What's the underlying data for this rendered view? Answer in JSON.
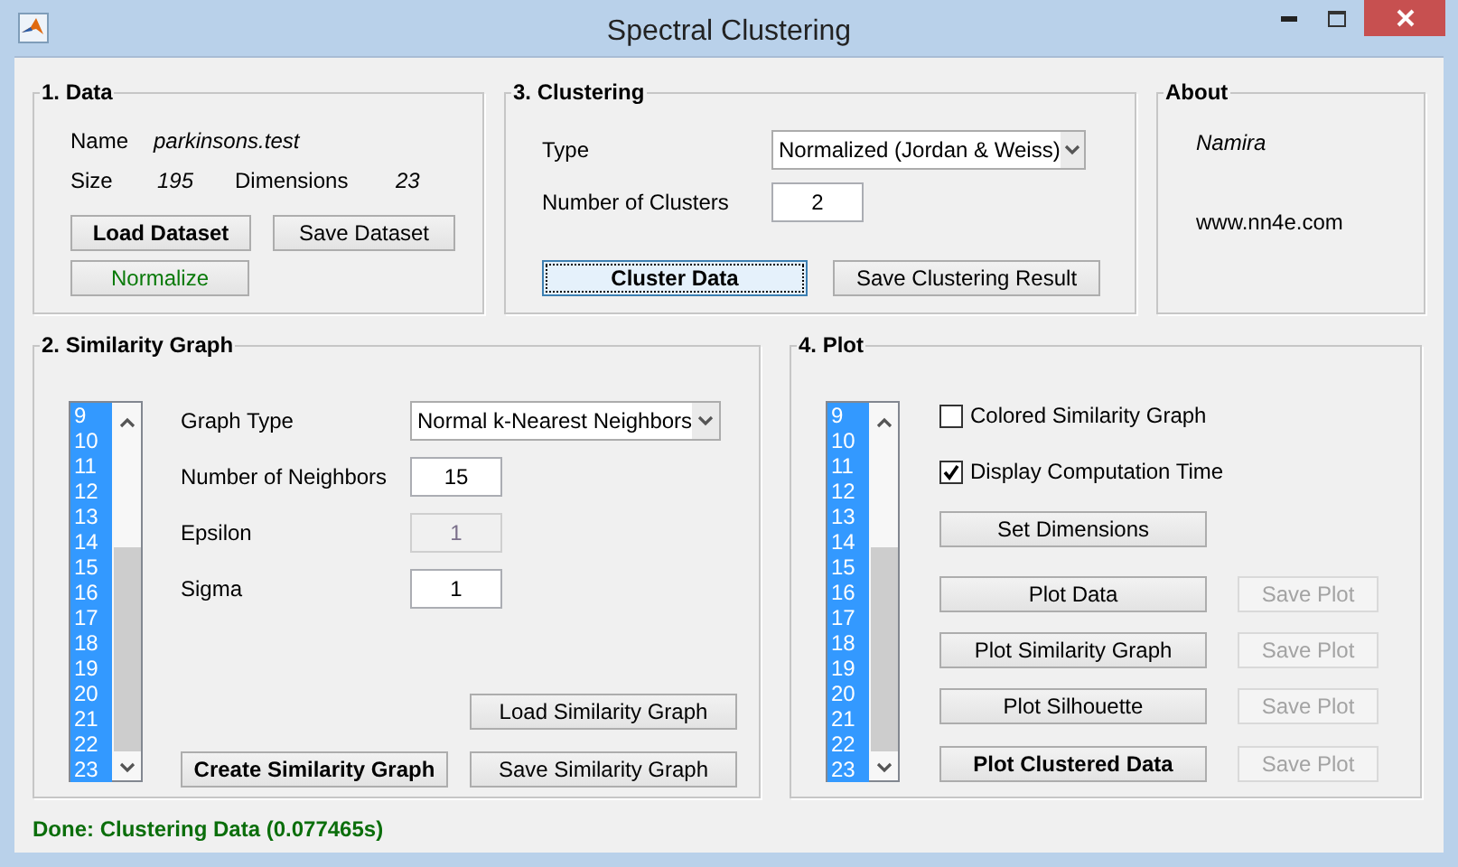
{
  "window": {
    "title": "Spectral Clustering"
  },
  "data_panel": {
    "title": "1. Data",
    "name_label": "Name",
    "name_value": "parkinsons.test",
    "size_label": "Size",
    "size_value": "195",
    "dimensions_label": "Dimensions",
    "dimensions_value": "23",
    "buttons": [
      {
        "label": "Load Dataset",
        "kind": "bold"
      },
      {
        "label": "Save Dataset",
        "kind": "plain"
      },
      {
        "label": "Normalize",
        "kind": "green"
      }
    ]
  },
  "clustering_panel": {
    "title": "3. Clustering",
    "type_label": "Type",
    "type_value": "Normalized (Jordan & Weiss)",
    "clusters_label": "Number of Clusters",
    "clusters_value": "2",
    "buttons": [
      {
        "label": "Cluster Data",
        "kind": "bold",
        "focused": true
      },
      {
        "label": "Save Clustering Result",
        "kind": "plain",
        "focused": false
      }
    ]
  },
  "about_panel": {
    "title": "About",
    "author": "Namira",
    "website": "www.nn4e.com"
  },
  "similarity_panel": {
    "title": "2. Similarity Graph",
    "list": [
      {
        "label": "9",
        "selected": true
      },
      {
        "label": "10",
        "selected": true
      },
      {
        "label": "11",
        "selected": true
      },
      {
        "label": "12",
        "selected": true
      },
      {
        "label": "13",
        "selected": true
      },
      {
        "label": "14",
        "selected": true
      },
      {
        "label": "15",
        "selected": true
      },
      {
        "label": "16",
        "selected": true
      },
      {
        "label": "17",
        "selected": true
      },
      {
        "label": "18",
        "selected": true
      },
      {
        "label": "19",
        "selected": true
      },
      {
        "label": "20",
        "selected": true
      },
      {
        "label": "21",
        "selected": true
      },
      {
        "label": "22",
        "selected": true
      },
      {
        "label": "23",
        "selected": true
      }
    ],
    "graph_type_label": "Graph Type",
    "graph_type_value": "Normal k-Nearest Neighbors",
    "fields": [
      {
        "label": "Number of Neighbors",
        "value": "15",
        "disabled": false
      },
      {
        "label": "Epsilon",
        "value": "1",
        "disabled": true
      },
      {
        "label": "Sigma",
        "value": "1",
        "disabled": false
      }
    ],
    "load_button": {
      "label": "Load Similarity Graph"
    },
    "create_button": {
      "label": "Create Similarity Graph",
      "kind": "bold"
    },
    "save_button": {
      "label": "Save Similarity Graph"
    }
  },
  "plot_panel": {
    "title": "4. Plot",
    "list": [
      {
        "label": "9",
        "selected": true
      },
      {
        "label": "10",
        "selected": true
      },
      {
        "label": "11",
        "selected": true
      },
      {
        "label": "12",
        "selected": true
      },
      {
        "label": "13",
        "selected": true
      },
      {
        "label": "14",
        "selected": true
      },
      {
        "label": "15",
        "selected": true
      },
      {
        "label": "16",
        "selected": true
      },
      {
        "label": "17",
        "selected": true
      },
      {
        "label": "18",
        "selected": true
      },
      {
        "label": "19",
        "selected": true
      },
      {
        "label": "20",
        "selected": true
      },
      {
        "label": "21",
        "selected": true
      },
      {
        "label": "22",
        "selected": true
      },
      {
        "label": "23",
        "selected": true
      }
    ],
    "checkboxes": [
      {
        "label": "Colored Similarity Graph",
        "checked": false
      },
      {
        "label": "Display Computation Time",
        "checked": true
      }
    ],
    "dimensions_button": {
      "label": "Set Dimensions"
    },
    "plot_rows": [
      {
        "plot": {
          "label": "Plot Data",
          "kind": "plain"
        },
        "save": {
          "label": "Save Plot",
          "disabled": true
        }
      },
      {
        "plot": {
          "label": "Plot Similarity Graph",
          "kind": "plain"
        },
        "save": {
          "label": "Save Plot",
          "disabled": true
        }
      },
      {
        "plot": {
          "label": "Plot Silhouette",
          "kind": "plain"
        },
        "save": {
          "label": "Save Plot",
          "disabled": true
        }
      },
      {
        "plot": {
          "label": "Plot Clustered Data",
          "kind": "bold"
        },
        "save": {
          "label": "Save Plot",
          "disabled": true
        }
      }
    ]
  },
  "status_bar": {
    "text": "Done: Clustering Data (0.077465s)"
  }
}
